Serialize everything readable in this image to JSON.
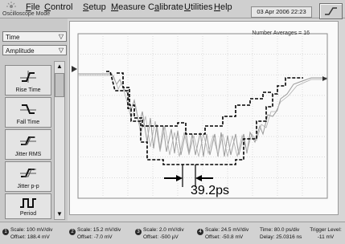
{
  "menu": [
    "File",
    "Control",
    "Setup",
    "Measure",
    "Calibrate",
    "Utilities",
    "Help"
  ],
  "menu_underline": [
    "F",
    "C",
    "S",
    "M",
    "a",
    "U",
    "H"
  ],
  "mode_label": "Oscilloscope Mode",
  "datetime": "03 Apr 2006  22:23",
  "left": {
    "mode_select": "Time",
    "measure_select": "Amplitude",
    "tools": [
      "Rise Time",
      "Fall Time",
      "Jitter RMS",
      "Jitter p-p",
      "Period"
    ]
  },
  "display": {
    "averages": "Number Averages = 16",
    "measurement": "39.2ps"
  },
  "status": {
    "channels": [
      {
        "num": "1",
        "scale": "Scale: 100 mV/div",
        "offset": "Offset: 188.4 mV"
      },
      {
        "num": "2",
        "scale": "Scale: 15.2 mV/div",
        "offset": "Offset: -7.0 mV"
      },
      {
        "num": "3",
        "scale": "Scale: 2.0 mV/div",
        "offset": "Offset: -500 µV"
      },
      {
        "num": "4",
        "scale": "Scale: 24.5 mV/div",
        "offset": "Offset: -50.8 mV"
      }
    ],
    "time": "Time: 80.0 ps/div",
    "delay": "Delay: 25.0316 ns",
    "trigger_label": "Trigger Level:",
    "trigger_value": "-11 mV"
  }
}
